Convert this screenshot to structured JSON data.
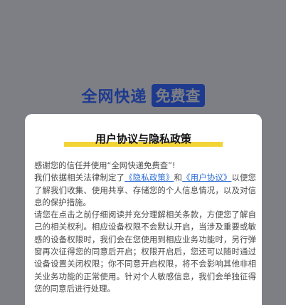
{
  "logo": {
    "main": "全网快递",
    "badge": "免费查"
  },
  "dialog": {
    "title": "用户协议与隐私政策",
    "line1": "感谢您的信任并使用“全网快递免费查”!",
    "p1_pre": "我们依据相关法律制定了",
    "privacy_link": "《隐私政策》",
    "and_text": "和",
    "user_link": "《用户协议》",
    "p1_post": "以便您了解我们收集、使用共享、存储您的个人信息情况，以及对信息的保护措施。",
    "p2": "请您在点击之前仔细阅读并充分理解相关条款，方便您了解自己的相关权利。相应设备权限不会默认开启，当涉及重要或敏感的设备权限时，我们会在您使用到相应业务功能时，另行弹窗再次征得您的同意后开启；权限开启后，您还可以随时通过设备设置关闭权限；你不同意开启权限，将不会影响其他非相关业务功能的正常使用。针对个人敏感信息，我们会单独征得您的同意后进行处理。"
  }
}
